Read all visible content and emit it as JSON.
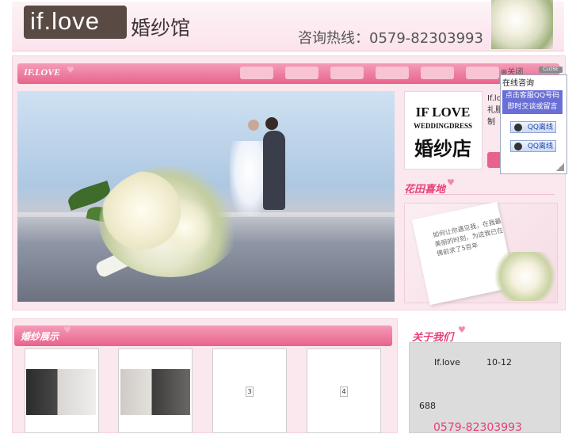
{
  "header": {
    "logo_en": "if.love",
    "logo_cn": "婚纱馆",
    "hotline": "咨询热线：0579-82303993"
  },
  "banner": {
    "title": "IF.LOVE",
    "tab_count": 7
  },
  "side_logo": {
    "line1": "IF LOVE",
    "line2": "WEDDINGDRESS",
    "line3": "婚纱店"
  },
  "intro": {
    "text": "If.lo 礼服 制"
  },
  "garden": {
    "heading": "花田喜地",
    "card_text": "如何让你遇见我，在我最美丽的时刻，为这我已在佛前求了5百年"
  },
  "qq_widget": {
    "close_label": "⊗关闭",
    "close_button": "CLOSE",
    "header": "在线咨询",
    "notice": "点击客服QQ号码即时交谈或留言",
    "buttons": [
      "QQ离线",
      "QQ离线"
    ]
  },
  "dress_section": {
    "title": "婚纱展示",
    "placeholders": [
      "3",
      "4"
    ]
  },
  "about": {
    "heading": "关于我们",
    "name": "If.love",
    "date": "10-12",
    "number": "688",
    "phone": "0579-82303993"
  },
  "colors": {
    "accent_pink": "#e8638c",
    "heading_pink": "#e8407a",
    "qq_blue": "#6a6fd6"
  }
}
